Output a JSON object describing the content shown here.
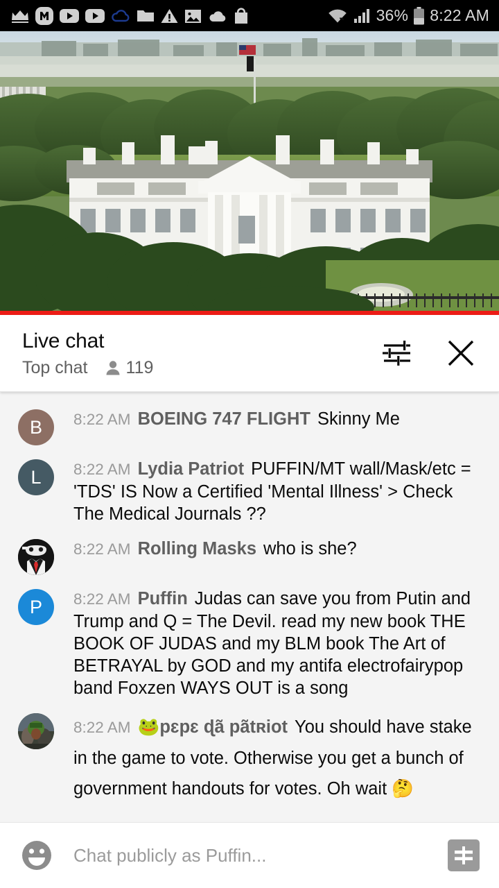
{
  "status_bar": {
    "left_icons": [
      "crown-icon",
      "monogram-m-icon",
      "youtube-icon",
      "youtube-icon",
      "cloud-outline-icon",
      "folder-icon",
      "warning-triangle-icon",
      "image-icon",
      "cloud-filled-icon",
      "shopping-bag-icon"
    ],
    "wifi_icon": "wifi-icon",
    "signal_icon": "signal-bars-icon",
    "battery_percent": "36%",
    "battery_icon": "battery-icon",
    "time": "8:22 AM"
  },
  "video": {
    "name": "white-house-live-stream",
    "progress_color": "#ec1c16",
    "progress_percent": 100
  },
  "chat_header": {
    "title": "Live chat",
    "mode": "Top chat",
    "viewer_icon": "person-icon",
    "viewer_count": "119",
    "settings_icon": "tune-sliders-icon",
    "close_icon": "close-icon"
  },
  "messages": [
    {
      "id": "msg-boeing",
      "timestamp": "8:22 AM",
      "author": "BOEING 747 FLIGHT",
      "text": "Skinny Me",
      "avatar": {
        "type": "letter",
        "letter": "B",
        "color": "#8d6f64"
      }
    },
    {
      "id": "msg-lydia",
      "timestamp": "8:22 AM",
      "author": "Lydia Patriot",
      "text": "PUFFIN/MT wall/Mask/etc = 'TDS' IS Now a Certified 'Mental Illness' > Check The Medical Journals ??",
      "avatar": {
        "type": "letter",
        "letter": "L",
        "color": "#455a64"
      }
    },
    {
      "id": "msg-rolling-masks",
      "timestamp": "8:22 AM",
      "author": "Rolling Masks",
      "text": "who is she?",
      "avatar": {
        "type": "image",
        "name": "masked-man-avatar",
        "color": "#1a1a1a"
      }
    },
    {
      "id": "msg-puffin",
      "timestamp": "8:22 AM",
      "author": "Puffin",
      "text": "Judas can save you from Putin and Trump and Q = The Devil. read my new book THE BOOK OF JUDAS and my BLM book The Art of BETRAYAL by GOD and my antifa electrofairypop band Foxzen WAYS OUT is a song",
      "avatar": {
        "type": "letter",
        "letter": "P",
        "color": "#1b89d8"
      }
    },
    {
      "id": "msg-pepe",
      "timestamp": "8:22 AM",
      "author": "🐸pɛpɛ ɖã pãtʀiot",
      "text": "You should have stake in the game to vote. Otherwise you get a bunch of government handouts for votes. Oh wait 🤔",
      "avatar": {
        "type": "image",
        "name": "photo-avatar",
        "color": "#4a5a3a"
      }
    }
  ],
  "input_bar": {
    "emoji_icon": "emoji-smiley-icon",
    "placeholder": "Chat publicly as Puffin...",
    "superchat_icon": "superchat-dollar-icon"
  },
  "colors": {
    "chat_background": "#f4f4f4",
    "accent_red": "#ec1c16",
    "author_gray": "#606060",
    "timestamp_gray": "#9a9a9a"
  }
}
